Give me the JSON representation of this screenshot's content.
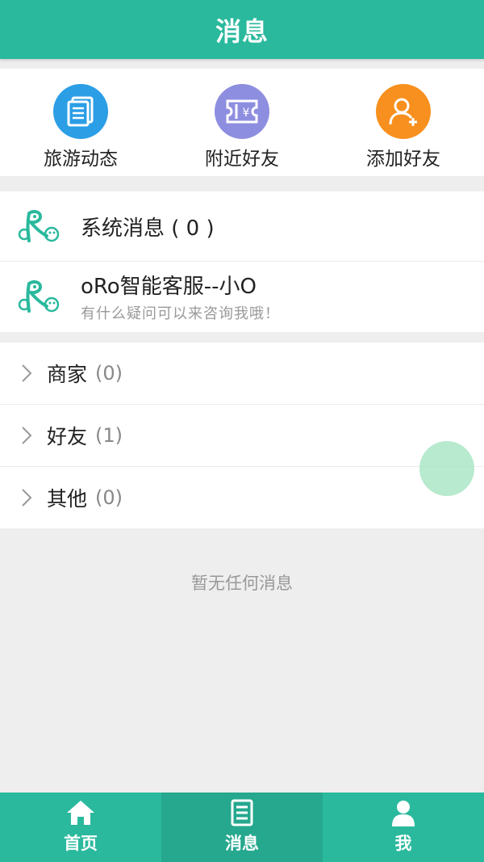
{
  "header": {
    "title": "消息"
  },
  "quick_actions": [
    {
      "label": "旅游动态",
      "icon": "document-icon",
      "color": "#2b9ee6"
    },
    {
      "label": "附近好友",
      "icon": "ticket-icon",
      "color": "#8e8ee0"
    },
    {
      "label": "添加好友",
      "icon": "add-user-icon",
      "color": "#f7901e"
    }
  ],
  "messages": [
    {
      "title": "系统消息 ( 0 )",
      "subtitle": ""
    },
    {
      "title": "oRo智能客服--小O",
      "subtitle": "有什么疑问可以来咨询我哦！"
    }
  ],
  "groups": [
    {
      "name": "商家",
      "count": "(0)"
    },
    {
      "name": "好友",
      "count": "(1)"
    },
    {
      "name": "其他",
      "count": "(0)"
    }
  ],
  "empty_text": "暂无任何消息",
  "tabs": [
    {
      "label": "首页",
      "icon": "home-icon",
      "active": false
    },
    {
      "label": "消息",
      "icon": "message-icon",
      "active": true
    },
    {
      "label": "我",
      "icon": "user-icon",
      "active": false
    }
  ],
  "colors": {
    "primary": "#2ab99d",
    "active_tab": "#25a88e",
    "floating_button": "#9fe3bd"
  }
}
